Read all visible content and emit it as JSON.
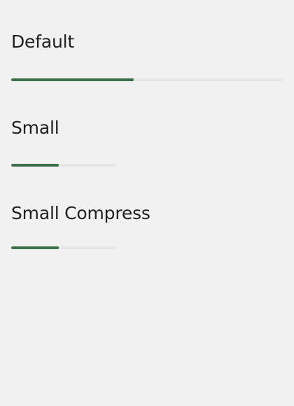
{
  "colors": {
    "fill": "#3d6e4c",
    "track": "#e6e6e6",
    "background": "#f1f1f1"
  },
  "progress_bars": [
    {
      "label": "Default",
      "value": 0.45
    },
    {
      "label": "Small",
      "value": 0.45
    },
    {
      "label": "Small Compress",
      "value": 0.45
    }
  ]
}
